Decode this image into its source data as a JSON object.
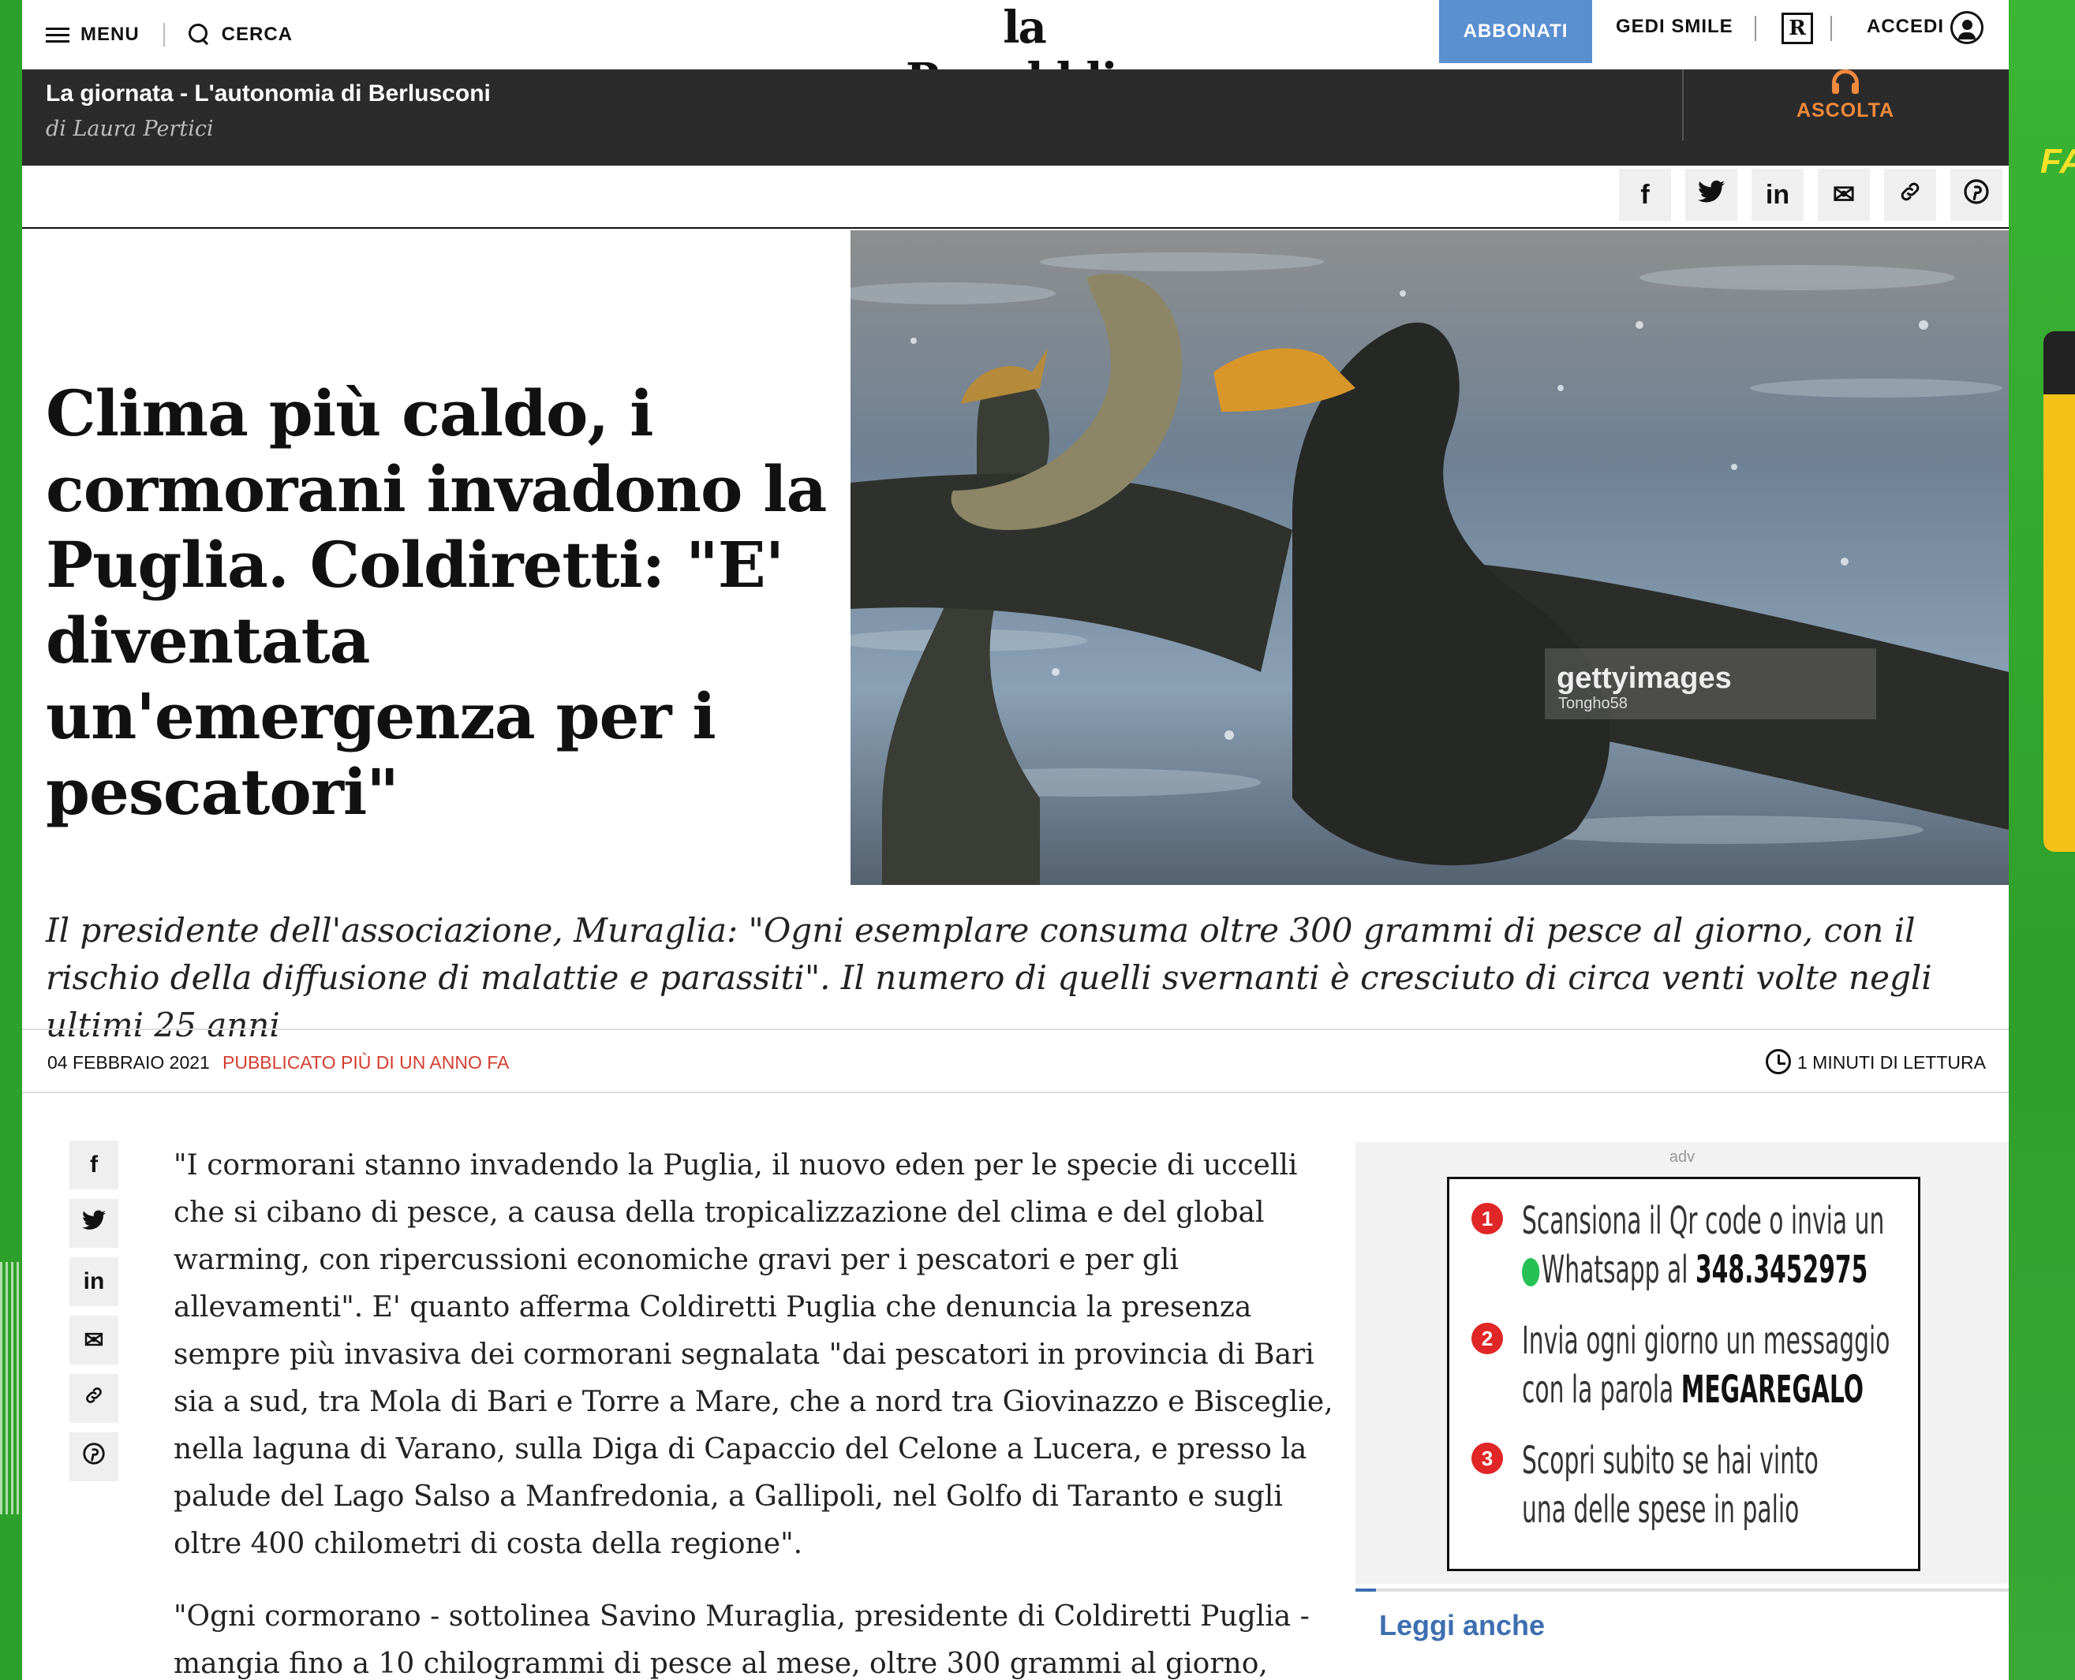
{
  "header": {
    "menu_label": "MENU",
    "search_label": "CERCA",
    "logo": "la Repubblica",
    "subscribe_label": "ABBONATI",
    "gedi_label": "GEDI SMILE",
    "r_label": "R",
    "login_label": "ACCEDI"
  },
  "podcast": {
    "title": "La giornata - L'autonomia di Berlusconi",
    "author": "di Laura Pertici",
    "listen_label": "ASCOLTA"
  },
  "share_icons": [
    "facebook-icon",
    "twitter-icon",
    "linkedin-icon",
    "email-icon",
    "link-icon",
    "pinterest-icon"
  ],
  "share_glyphs": {
    "facebook": "f",
    "twitter": "🐦",
    "linkedin": "in",
    "email": "✉",
    "link": "🔗",
    "pinterest": "℗"
  },
  "article": {
    "headline": "Clima più caldo, i cormorani invadono la Puglia. Coldiretti: \"E' diventata un'emergenza per i pescatori\"",
    "image_credit_brand": "gettyimages",
    "image_credit_author": "Tongho58",
    "summary": "Il presidente dell'associazione, Muraglia: \"Ogni esemplare consuma oltre 300 grammi di pesce al giorno, con il rischio della diffusione di malattie e parassiti\". Il numero di quelli svernanti è cresciuto di circa venti volte negli ultimi 25 anni",
    "date": "04 FEBBRAIO 2021",
    "published_note": "PUBBLICATO PIÙ DI UN ANNO FA",
    "reading_time": "1 MINUTI DI LETTURA",
    "paragraph_1": "\"I cormorani stanno invadendo la Puglia, il nuovo eden per le specie di uccelli che si cibano di pesce, a causa della tropicalizzazione del clima e del global warming, con ripercussioni economiche gravi per i pescatori e per gli allevamenti\". E' quanto afferma Coldiretti Puglia che denuncia la presenza sempre più invasiva dei cormorani segnalata \"dai pescatori in provincia di Bari sia a sud, tra Mola di Bari e Torre a Mare, che a nord tra Giovinazzo e Bisceglie, nella laguna di Varano, sulla Diga di Capaccio del Celone a Lucera, e presso la palude del Lago Salso a Manfredonia, a Gallipoli, nel Golfo di Taranto e sugli oltre 400 chilometri di costa della regione\".",
    "paragraph_2": "\"Ogni cormorano - sottolinea Savino Muraglia, presidente di Coldiretti Puglia - mangia fino a 10 chilogrammi di pesce al mese, oltre 300 grammi al giorno, lasciando tra l'altro"
  },
  "ad": {
    "label": "adv",
    "step1_num": "1",
    "step1_line1": "Scansiona il Qr code o invia un",
    "step1_line2a": "Whatsapp al ",
    "step1_line2b": "348.3452975",
    "step2_num": "2",
    "step2_line1": "Invia ogni giorno un messaggio",
    "step2_line2a": "con la parola ",
    "step2_line2b": "MEGAREGALO",
    "step3_num": "3",
    "step3_line1": "Scopri subito se hai vinto",
    "step3_line2": "una delle spese in palio"
  },
  "related": {
    "title": "Leggi anche"
  },
  "colors": {
    "accent_blue": "#5a8fd0",
    "podcast_orange": "#f08a3e",
    "published_red": "#d43d2f",
    "background_green": "#2ea12a"
  }
}
